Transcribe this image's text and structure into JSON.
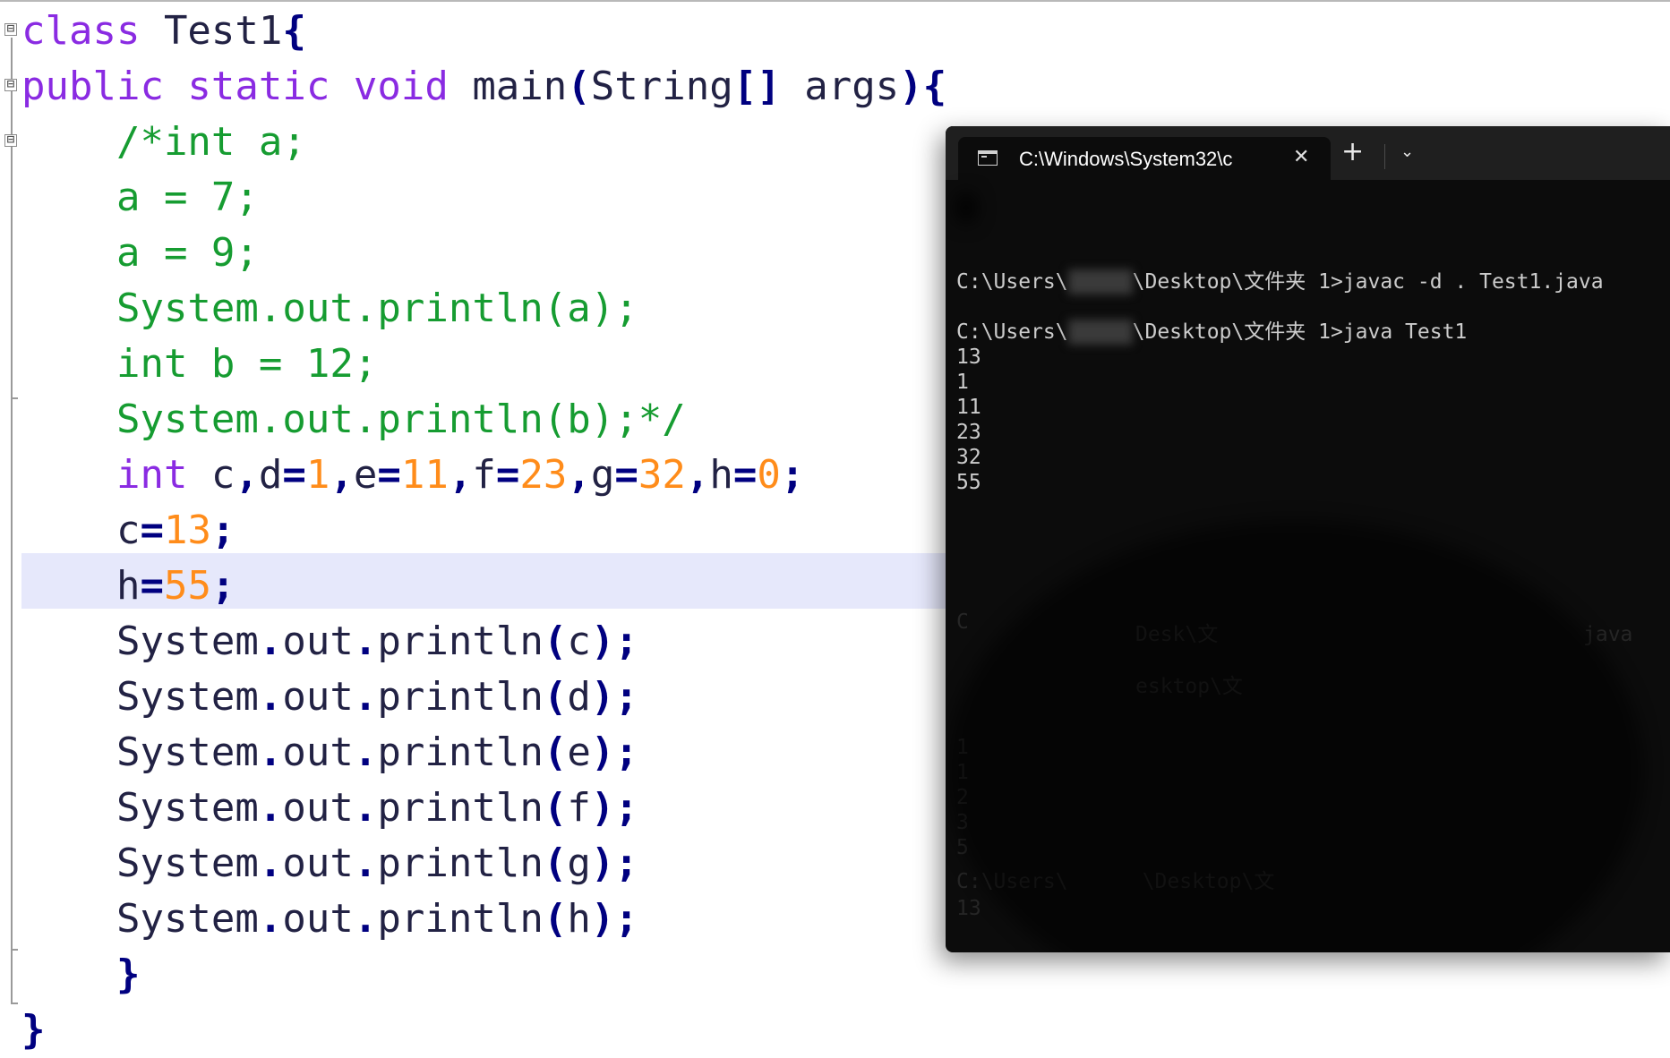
{
  "editor": {
    "lines": [
      [
        {
          "t": "class",
          "c": "kw"
        },
        {
          "t": " Test1",
          "c": "id"
        },
        {
          "t": "{",
          "c": "op"
        }
      ],
      [
        {
          "t": "public static void",
          "c": "kw"
        },
        {
          "t": " main",
          "c": "id"
        },
        {
          "t": "(",
          "c": "op"
        },
        {
          "t": "String",
          "c": "id"
        },
        {
          "t": "[]",
          "c": "op"
        },
        {
          "t": " args",
          "c": "id"
        },
        {
          "t": "){",
          "c": "op"
        }
      ],
      [
        {
          "t": "    /*int a;",
          "c": "cmt"
        }
      ],
      [
        {
          "t": "    a = 7;",
          "c": "cmt"
        }
      ],
      [
        {
          "t": "    a = 9;",
          "c": "cmt"
        }
      ],
      [
        {
          "t": "    System.out.println(a);",
          "c": "cmt"
        }
      ],
      [
        {
          "t": "    int b = 12;",
          "c": "cmt"
        }
      ],
      [
        {
          "t": "    System.out.println(b);*/",
          "c": "cmt"
        }
      ],
      [
        {
          "t": "    int",
          "c": "kw"
        },
        {
          "t": " c",
          "c": "id"
        },
        {
          "t": ",",
          "c": "op"
        },
        {
          "t": "d",
          "c": "id"
        },
        {
          "t": "=",
          "c": "op"
        },
        {
          "t": "1",
          "c": "num"
        },
        {
          "t": ",",
          "c": "op"
        },
        {
          "t": "e",
          "c": "id"
        },
        {
          "t": "=",
          "c": "op"
        },
        {
          "t": "11",
          "c": "num"
        },
        {
          "t": ",",
          "c": "op"
        },
        {
          "t": "f",
          "c": "id"
        },
        {
          "t": "=",
          "c": "op"
        },
        {
          "t": "23",
          "c": "num"
        },
        {
          "t": ",",
          "c": "op"
        },
        {
          "t": "g",
          "c": "id"
        },
        {
          "t": "=",
          "c": "op"
        },
        {
          "t": "32",
          "c": "num"
        },
        {
          "t": ",",
          "c": "op"
        },
        {
          "t": "h",
          "c": "id"
        },
        {
          "t": "=",
          "c": "op"
        },
        {
          "t": "0",
          "c": "num"
        },
        {
          "t": ";",
          "c": "op"
        }
      ],
      [
        {
          "t": "    c",
          "c": "id"
        },
        {
          "t": "=",
          "c": "op"
        },
        {
          "t": "13",
          "c": "num"
        },
        {
          "t": ";",
          "c": "op"
        }
      ],
      [
        {
          "t": "    h",
          "c": "id"
        },
        {
          "t": "=",
          "c": "op"
        },
        {
          "t": "55",
          "c": "num"
        },
        {
          "t": ";",
          "c": "op"
        }
      ],
      [
        {
          "t": "    System",
          "c": "id"
        },
        {
          "t": ".",
          "c": "op"
        },
        {
          "t": "out",
          "c": "id"
        },
        {
          "t": ".",
          "c": "op"
        },
        {
          "t": "println",
          "c": "id"
        },
        {
          "t": "(",
          "c": "op"
        },
        {
          "t": "c",
          "c": "id"
        },
        {
          "t": ");",
          "c": "op"
        }
      ],
      [
        {
          "t": "    System",
          "c": "id"
        },
        {
          "t": ".",
          "c": "op"
        },
        {
          "t": "out",
          "c": "id"
        },
        {
          "t": ".",
          "c": "op"
        },
        {
          "t": "println",
          "c": "id"
        },
        {
          "t": "(",
          "c": "op"
        },
        {
          "t": "d",
          "c": "id"
        },
        {
          "t": ");",
          "c": "op"
        }
      ],
      [
        {
          "t": "    System",
          "c": "id"
        },
        {
          "t": ".",
          "c": "op"
        },
        {
          "t": "out",
          "c": "id"
        },
        {
          "t": ".",
          "c": "op"
        },
        {
          "t": "println",
          "c": "id"
        },
        {
          "t": "(",
          "c": "op"
        },
        {
          "t": "e",
          "c": "id"
        },
        {
          "t": ");",
          "c": "op"
        }
      ],
      [
        {
          "t": "    System",
          "c": "id"
        },
        {
          "t": ".",
          "c": "op"
        },
        {
          "t": "out",
          "c": "id"
        },
        {
          "t": ".",
          "c": "op"
        },
        {
          "t": "println",
          "c": "id"
        },
        {
          "t": "(",
          "c": "op"
        },
        {
          "t": "f",
          "c": "id"
        },
        {
          "t": ");",
          "c": "op"
        }
      ],
      [
        {
          "t": "    System",
          "c": "id"
        },
        {
          "t": ".",
          "c": "op"
        },
        {
          "t": "out",
          "c": "id"
        },
        {
          "t": ".",
          "c": "op"
        },
        {
          "t": "println",
          "c": "id"
        },
        {
          "t": "(",
          "c": "op"
        },
        {
          "t": "g",
          "c": "id"
        },
        {
          "t": ");",
          "c": "op"
        }
      ],
      [
        {
          "t": "    System",
          "c": "id"
        },
        {
          "t": ".",
          "c": "op"
        },
        {
          "t": "out",
          "c": "id"
        },
        {
          "t": ".",
          "c": "op"
        },
        {
          "t": "println",
          "c": "id"
        },
        {
          "t": "(",
          "c": "op"
        },
        {
          "t": "h",
          "c": "id"
        },
        {
          "t": ");",
          "c": "op"
        }
      ],
      [
        {
          "t": "    }",
          "c": "op"
        }
      ],
      [
        {
          "t": "}",
          "c": "op"
        }
      ]
    ],
    "fold_markers": [
      "⊟",
      "⊟",
      "⊟"
    ]
  },
  "terminal": {
    "tab_title": "C:\\Windows\\System32\\c",
    "tab_close": "✕",
    "new_tab": "+",
    "dropdown": "⌄",
    "prompt1_prefix": "C:\\Users\\",
    "prompt1_suffix": "\\Desktop\\文件夹 1>javac -d . Test1.java",
    "prompt2_prefix": "C:\\Users\\",
    "prompt2_suffix": "\\Desktop\\文件夹 1>java Test1",
    "output": [
      "13",
      "1",
      "11",
      "23",
      "32",
      "55"
    ]
  }
}
